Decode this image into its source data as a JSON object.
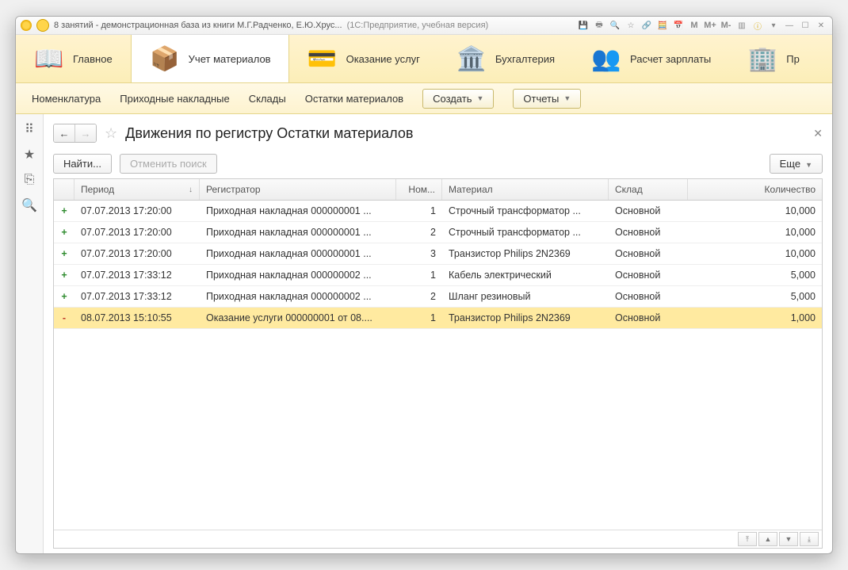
{
  "titlebar": {
    "app_text": "8 занятий - демонстрационная база из книги М.Г.Радченко, Е.Ю.Хрус...",
    "app_sub": "(1С:Предприятие, учебная версия)",
    "m1": "M",
    "m2": "M+",
    "m3": "M-"
  },
  "sections": [
    {
      "label": "Главное"
    },
    {
      "label": "Учет материалов",
      "active": true
    },
    {
      "label": "Оказание услуг"
    },
    {
      "label": "Бухгалтерия"
    },
    {
      "label": "Расчет зарплаты"
    },
    {
      "label": "Пр"
    }
  ],
  "commands": {
    "links": [
      "Номенклатура",
      "Приходные накладные",
      "Склады",
      "Остатки материалов"
    ],
    "create": "Создать",
    "reports": "Отчеты"
  },
  "page": {
    "title": "Движения по регистру Остатки материалов",
    "find": "Найти...",
    "cancel_find": "Отменить поиск",
    "more": "Еще"
  },
  "columns": {
    "period": "Период",
    "registrar": "Регистратор",
    "num": "Ном...",
    "material": "Материал",
    "warehouse": "Склад",
    "qty": "Количество"
  },
  "rows": [
    {
      "sign": "+",
      "period": "07.07.2013 17:20:00",
      "reg": "Приходная накладная 000000001 ...",
      "num": "1",
      "mat": "Строчный трансформатор ...",
      "wh": "Основной",
      "qty": "10,000"
    },
    {
      "sign": "+",
      "period": "07.07.2013 17:20:00",
      "reg": "Приходная накладная 000000001 ...",
      "num": "2",
      "mat": "Строчный трансформатор ...",
      "wh": "Основной",
      "qty": "10,000"
    },
    {
      "sign": "+",
      "period": "07.07.2013 17:20:00",
      "reg": "Приходная накладная 000000001 ...",
      "num": "3",
      "mat": "Транзистор Philips 2N2369",
      "wh": "Основной",
      "qty": "10,000"
    },
    {
      "sign": "+",
      "period": "07.07.2013 17:33:12",
      "reg": "Приходная накладная 000000002 ...",
      "num": "1",
      "mat": "Кабель электрический",
      "wh": "Основной",
      "qty": "5,000"
    },
    {
      "sign": "+",
      "period": "07.07.2013 17:33:12",
      "reg": "Приходная накладная 000000002 ...",
      "num": "2",
      "mat": "Шланг резиновый",
      "wh": "Основной",
      "qty": "5,000"
    },
    {
      "sign": "-",
      "period": "08.07.2013 15:10:55",
      "reg": "Оказание услуги 000000001 от 08....",
      "num": "1",
      "mat": "Транзистор Philips 2N2369",
      "wh": "Основной",
      "qty": "1,000",
      "sel": true
    }
  ]
}
